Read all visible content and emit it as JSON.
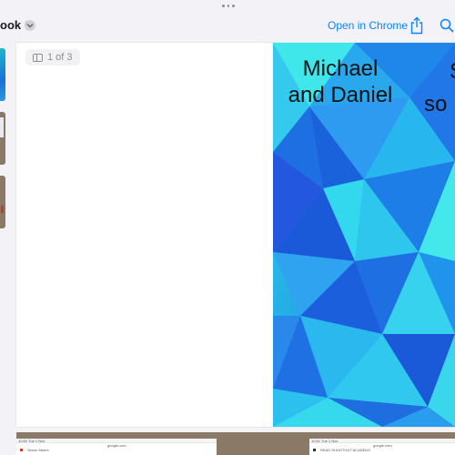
{
  "header": {
    "title": "ook 6",
    "open_in_chrome_label": "Open in Chrome"
  },
  "page_indicator": "1 of 3",
  "cover": {
    "title_line_1": "Michael",
    "title_line_2": "and Daniel",
    "partial_line_1": "S",
    "partial_line_2": "so"
  },
  "sidebar": {
    "thumbnails": [
      "page-1",
      "page-2",
      "page-3"
    ]
  },
  "bottom_preview": {
    "left": {
      "status": "10:50 Tue 1 Nov",
      "url": "google.com",
      "item": "Simon Meers"
    },
    "right": {
      "status": "10:51 Tue 1 Nov",
      "url": "google.com",
      "item": "READ SHOOTOUT ACADEMY"
    }
  },
  "colors": {
    "accent": "#0a84ff",
    "cover_light": "#35e0e8",
    "cover_dark": "#1a5fe0"
  }
}
